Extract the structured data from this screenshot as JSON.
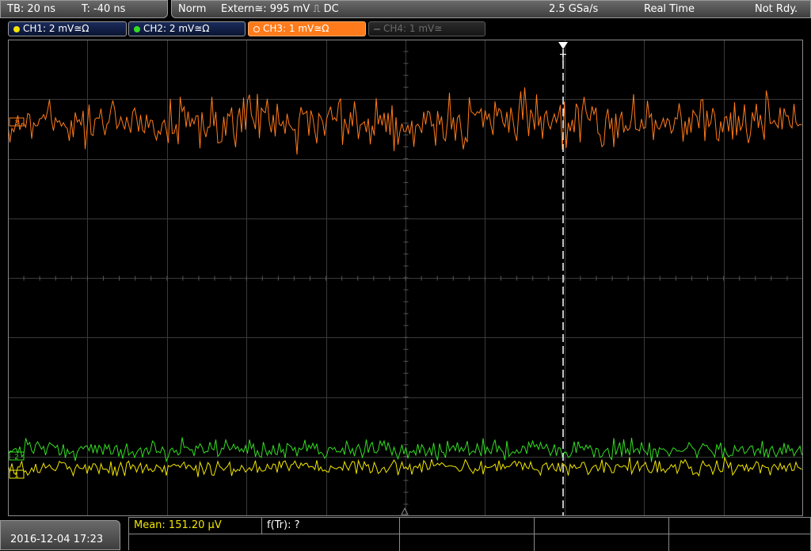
{
  "topbar": {
    "timebase": "TB: 20 ns",
    "trigger_pos": "T: -40 ns",
    "mode": "Norm",
    "trigger_info": "Extern≅: 995 mV ⎍ DC",
    "sample_rate": "2.5 GSa/s",
    "acq_mode": "Real Time",
    "status": "Not Rdy."
  },
  "channels": [
    {
      "label": "CH1: 2 mV≅Ω",
      "color": "#f2e600"
    },
    {
      "label": "CH2: 2 mV≅Ω",
      "color": "#33dd22"
    },
    {
      "label": "CH3: 1 mV≅Ω",
      "color": "#ff7a1a"
    },
    {
      "label": "CH4: 1 mV≅",
      "color": "#555555"
    }
  ],
  "markers": {
    "trigger_marker": "T",
    "ch1_marker": "1",
    "ch2_marker": "2",
    "ch3_marker": "3"
  },
  "bottom": {
    "datetime": "2016-12-04 17:23",
    "mean": "Mean: 151.20 µV",
    "ftr": "f(Tr): ?"
  },
  "colors": {
    "grid": "#3a3a3a",
    "ch1": "#f2e600",
    "ch2": "#33dd22",
    "ch3": "#ff7a1a"
  }
}
